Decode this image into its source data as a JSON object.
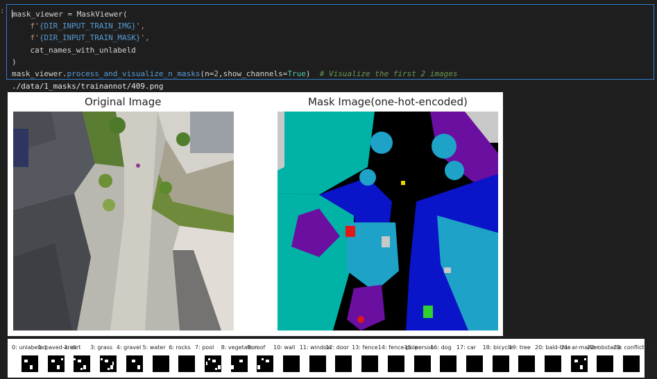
{
  "cell": {
    "prompt": ":",
    "lines": [
      [
        {
          "t": "mask_viewer = MaskViewer(",
          "c": "tok-plain"
        }
      ],
      [
        {
          "t": "    f'",
          "c": "tok-str"
        },
        {
          "t": "{DIR_INPUT_TRAIN_IMG}",
          "c": "tok-fn"
        },
        {
          "t": "',",
          "c": "tok-str"
        }
      ],
      [
        {
          "t": "    f'",
          "c": "tok-str"
        },
        {
          "t": "{DIR_INPUT_TRAIN_MASK}",
          "c": "tok-fn"
        },
        {
          "t": "',",
          "c": "tok-str"
        }
      ],
      [
        {
          "t": "    cat_names_with_unlabeld",
          "c": "tok-plain"
        }
      ],
      [
        {
          "t": ")",
          "c": "tok-plain"
        }
      ],
      [
        {
          "t": "mask_viewer.",
          "c": "tok-plain"
        },
        {
          "t": "process_and_visualize_n_masks",
          "c": "tok-fn"
        },
        {
          "t": "(n=",
          "c": "tok-plain"
        },
        {
          "t": "2",
          "c": "tok-num"
        },
        {
          "t": ",show_channels=",
          "c": "tok-plain"
        },
        {
          "t": "True",
          "c": "tok-const"
        },
        {
          "t": ")  ",
          "c": "tok-plain"
        },
        {
          "t": "# Visualize the first 2 images",
          "c": "tok-cmt"
        }
      ]
    ]
  },
  "output": {
    "path": "./data/1_masks/trainannot/409.png",
    "figure": {
      "left_title": "Original Image",
      "right_title": "Mask Image(one-hot-encoded)"
    },
    "channels": [
      "0: unlabeled",
      "1: paved-area",
      "2: dirt",
      "3: grass",
      "4: gravel",
      "5: water",
      "6: rocks",
      "7: pool",
      "8: vegetation",
      "9: roof",
      "10: wall",
      "11: window",
      "12: door",
      "13: fence",
      "14: fence-pole",
      "15: person",
      "16: dog",
      "17: car",
      "18: bicycle",
      "19: tree",
      "20: bald-tree",
      "21: ar-marker",
      "22: obstacle",
      "23: conflicting"
    ]
  },
  "colors": {
    "accent_border": "#2f7fd1",
    "mask_teal": "#00b3a6",
    "mask_black": "#000000",
    "mask_blue": "#0a14c8",
    "mask_cyan": "#1fa2c8",
    "mask_purple": "#6a0fa0",
    "mask_gray": "#c8c8c8",
    "mask_red": "#e01818",
    "mask_green": "#2fd02f"
  }
}
